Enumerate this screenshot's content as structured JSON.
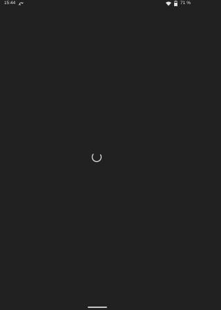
{
  "status_bar": {
    "time": "15:44",
    "battery_percent": "71 %",
    "icons": [
      "rotate-icon",
      "wifi-icon",
      "battery-icon"
    ]
  },
  "content": {
    "state": "loading",
    "spinner_color": "#d8d8d8"
  },
  "colors": {
    "background": "#212121",
    "text": "#e6e6e6",
    "nav_handle": "#c8c8c8"
  },
  "nav": {
    "icon": "gesture-handle-icon"
  }
}
